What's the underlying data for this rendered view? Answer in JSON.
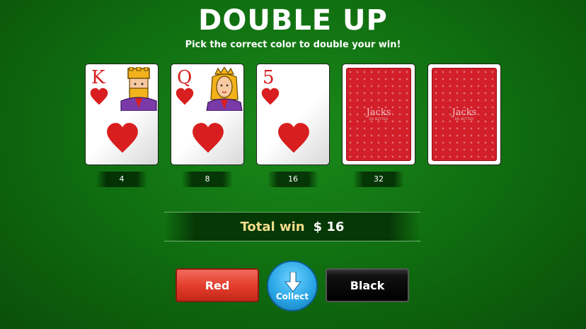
{
  "header": {
    "title": "DOUBLE UP",
    "subtitle": "Pick the correct color to double your win!"
  },
  "cards": [
    {
      "rank": "K",
      "suit": "heart",
      "state": "face",
      "figure": "king-icon",
      "multiplier": "4"
    },
    {
      "rank": "Q",
      "suit": "heart",
      "state": "face",
      "figure": "queen-icon",
      "multiplier": "8"
    },
    {
      "rank": "5",
      "suit": "heart",
      "state": "face",
      "figure": null,
      "multiplier": "16"
    },
    {
      "rank": null,
      "suit": null,
      "state": "back",
      "brand": "Jacks",
      "brand_sub": "OR BETTER",
      "multiplier": "32"
    },
    {
      "rank": null,
      "suit": null,
      "state": "back",
      "brand": "Jacks",
      "brand_sub": "OR BETTER",
      "multiplier": ""
    }
  ],
  "total": {
    "label": "Total win",
    "amount": "$ 16"
  },
  "buttons": {
    "red_label": "Red",
    "collect_label": "Collect",
    "black_label": "Black"
  },
  "colors": {
    "table_green": "#0f6b0f",
    "heart_red": "#d81e1e",
    "card_back_red": "#d21f2a",
    "collect_blue": "#2aa6e6",
    "total_label_gold": "#f3dc8a"
  },
  "icons": {
    "heart": "heart-icon",
    "king": "king-icon",
    "queen": "queen-icon",
    "collect": "arrow-down-icon"
  }
}
